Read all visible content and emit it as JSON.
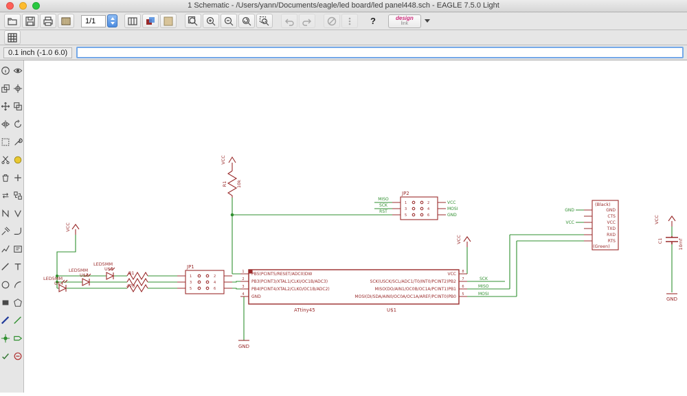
{
  "titlebar": {
    "title": "1 Schematic - /Users/yann/Documents/eagle/led board/led panel448.sch - EAGLE 7.5.0 Light"
  },
  "toolbar": {
    "sheet_value": "1/1",
    "help": "?",
    "design_link_line1": "design",
    "design_link_line2": "link"
  },
  "command_bar": {
    "coordinates": "0.1 inch (-1.0 6.0)",
    "command": ""
  },
  "colors": {
    "symbol": "#9a2b2b",
    "net": "#2f8f2f",
    "focus_ring": "#74a8e8",
    "titlebar_red": "#ff5f57",
    "titlebar_yellow": "#febc2e",
    "titlebar_green": "#28c840"
  },
  "schematic": {
    "vcc": "VCC",
    "gnd": "GND",
    "r1": {
      "name": "R1",
      "value": "10k"
    },
    "r_led": {
      "name": "R1",
      "value": "470"
    },
    "jp2": {
      "name": "JP2",
      "nets_left": [
        "MISO",
        "SCK",
        "RST"
      ],
      "nets_right": [
        "VCC",
        "MOSI",
        "GND"
      ],
      "pin_numbers": [
        "1",
        "2",
        "3",
        "4",
        "5",
        "6"
      ]
    },
    "jp1": {
      "name": "JP1",
      "pin_numbers": [
        "1",
        "2",
        "3",
        "4",
        "5",
        "6"
      ]
    },
    "ic": {
      "value": "ATtiny45",
      "name": "U$1",
      "pins_left": [
        "PB5(PCINT5/RESET/ADC0)DW",
        "PB3(PCINT3/XTAL1/CLKI/OC1B/ADC3)",
        "PB4(PCINT4/XTAL2/CLKO/OC1B/ADC2)",
        "GND"
      ],
      "pins_right": [
        "VCC",
        "SCK(USCK/SCL/ADC1/T0/INT0/PCINT2)PB2",
        "MISO(DO/AIN1/OC0B/OC1A/PCINT1)PB1",
        "MOSI(DI/SDA/AIN0/OC0A/OC1A/AREF/PCINT0)PB0"
      ],
      "pin_numbers_left": [
        "1",
        "2",
        "3",
        "4"
      ],
      "pin_numbers_right": [
        "8",
        "7",
        "6",
        "5"
      ],
      "net_labels": [
        "SCK",
        "MISO",
        "MOSI"
      ]
    },
    "leds": [
      {
        "value": "LED5MM",
        "name": "U$2"
      },
      {
        "value": "LED5MM",
        "name": "U$3"
      },
      {
        "value": "LED5MM",
        "name": "U$4"
      }
    ],
    "serial": {
      "top": "(Black)",
      "bottom": "(Green)",
      "pins": [
        "GND",
        "CTS",
        "VCC",
        "TXD",
        "RXD",
        "RTS"
      ],
      "ext": [
        "GND",
        "VCC"
      ]
    },
    "c1": {
      "name": "C1",
      "value": "10mf"
    }
  }
}
